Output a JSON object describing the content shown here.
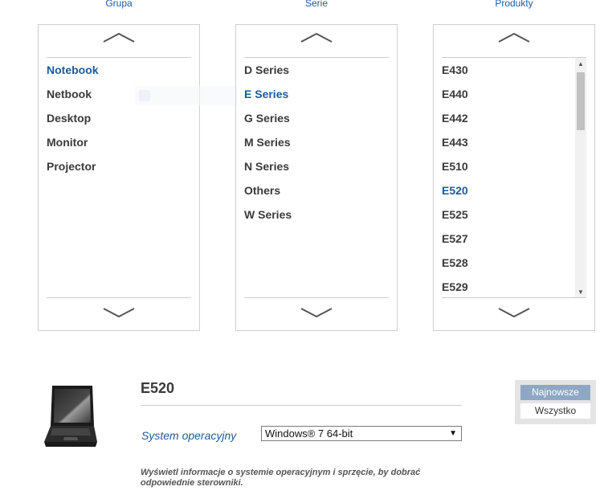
{
  "columns": {
    "group": {
      "title": "Grupa",
      "items": [
        "Notebook",
        "Netbook",
        "Desktop",
        "Monitor",
        "Projector"
      ],
      "selected": "Notebook"
    },
    "series": {
      "title": "Serie",
      "items": [
        "D Series",
        "E Series",
        "G Series",
        "M Series",
        "N Series",
        "Others",
        "W Series"
      ],
      "selected": "E Series"
    },
    "products": {
      "title": "Produkty",
      "items": [
        "E430",
        "E440",
        "E442",
        "E443",
        "E510",
        "E520",
        "E525",
        "E527",
        "E528",
        "E529"
      ],
      "selected": "E520"
    }
  },
  "product": {
    "title": "E520",
    "os_label": "System operacyjny",
    "os_selected": "Windows® 7 64-bit",
    "info_text": "Wyświetl informacje o systemie operacyjnym i sprzęcie, by dobrać odpowiednie sterowniki."
  },
  "tabs": {
    "newest": "Najnowsze",
    "all": "Wszystko"
  },
  "colors": {
    "accent": "#1b5a9c",
    "text": "#3a3a3a",
    "tab_active": "#8ea8c4"
  },
  "icons": {
    "up": "chevron-up-icon",
    "down": "chevron-down-icon"
  }
}
